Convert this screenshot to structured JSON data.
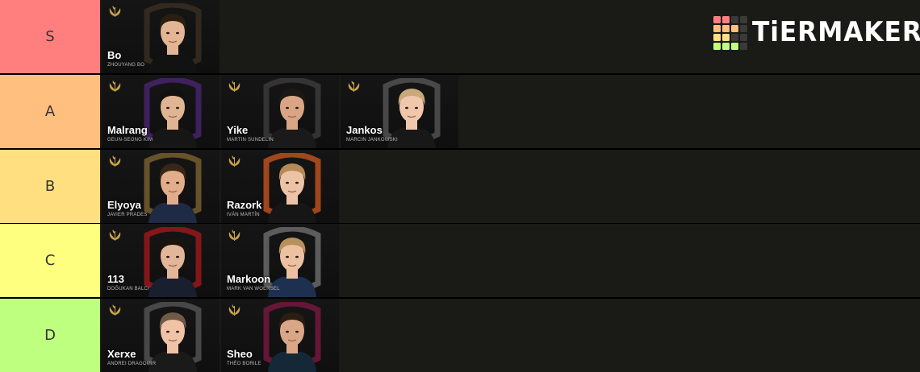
{
  "app": {
    "logo_text": "TiERMAKER"
  },
  "colors": {
    "tier_S": "#ff7f7f",
    "tier_A": "#ffbf7f",
    "tier_B": "#ffdf7f",
    "tier_C": "#ffff7f",
    "tier_D": "#bfff7f",
    "background": "#1a1a17",
    "laurel": "#c8a349"
  },
  "tiers": [
    {
      "label": "S",
      "players": [
        {
          "name": "Bo",
          "full_name": "ZHOUYANG BO"
        }
      ]
    },
    {
      "label": "A",
      "players": [
        {
          "name": "Malrang",
          "full_name": "GEUN-SEONG KIM"
        },
        {
          "name": "Yike",
          "full_name": "MARTIN SUNDELIN"
        },
        {
          "name": "Jankos",
          "full_name": "MARCIN JANKOWSKI"
        }
      ]
    },
    {
      "label": "B",
      "players": [
        {
          "name": "Elyoya",
          "full_name": "JAVIER PRADES"
        },
        {
          "name": "Razork",
          "full_name": "IVÁN MARTÍN"
        }
      ]
    },
    {
      "label": "C",
      "players": [
        {
          "name": "113",
          "full_name": "DOĞUKAN BALCI"
        },
        {
          "name": "Markoon",
          "full_name": "MARK VAN WOENSEL"
        }
      ]
    },
    {
      "label": "D",
      "players": [
        {
          "name": "Xerxe",
          "full_name": "ANDREI DRAGOMIR"
        },
        {
          "name": "Sheo",
          "full_name": "THÉO BORILE"
        }
      ]
    }
  ]
}
